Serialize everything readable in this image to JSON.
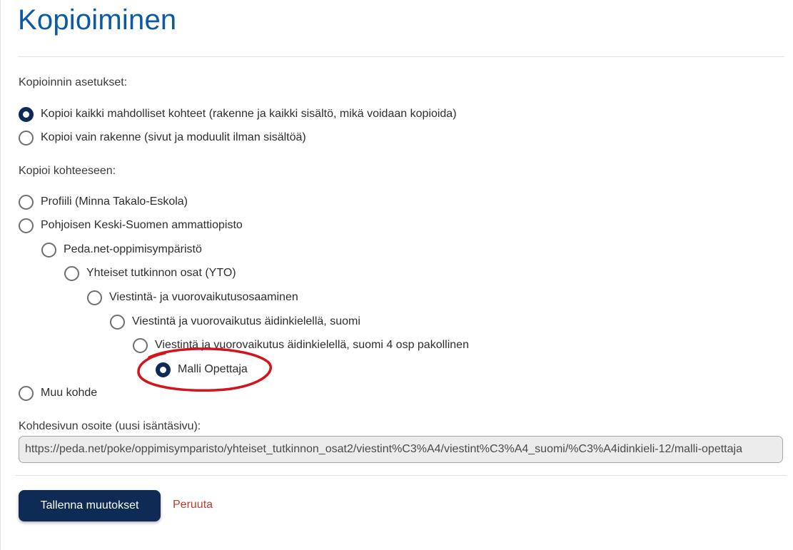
{
  "page": {
    "title": "Kopioiminen"
  },
  "copy_settings": {
    "label": "Kopioinnin asetukset:",
    "options": [
      {
        "label": "Kopioi kaikki mahdolliset kohteet (rakenne ja kaikki sisältö, mikä voidaan kopioida)",
        "checked": true
      },
      {
        "label": "Kopioi vain rakenne (sivut ja moduulit ilman sisältöä)",
        "checked": false
      }
    ]
  },
  "target": {
    "label": "Kopioi kohteeseen:",
    "options": [
      {
        "label": "Profiili (Minna Takalo-Eskola)",
        "checked": false
      },
      {
        "label": "Pohjoisen Keski-Suomen ammattiopisto",
        "checked": false
      },
      {
        "label": "Peda.net-oppimisympäristö",
        "checked": false
      },
      {
        "label": "Yhteiset tutkinnon osat (YTO)",
        "checked": false
      },
      {
        "label": "Viestintä- ja vuorovaikutusosaaminen",
        "checked": false
      },
      {
        "label": "Viestintä ja vuorovaikutus äidinkielellä, suomi",
        "checked": false
      },
      {
        "label": "Viestintä ja vuorovaikutus äidinkielellä, suomi 4 osp pakollinen",
        "checked": false
      },
      {
        "label": "Malli Opettaja",
        "checked": true
      },
      {
        "label": "Muu kohde",
        "checked": false
      }
    ]
  },
  "target_url": {
    "label": "Kohdesivun osoite (uusi isäntäsivu):",
    "value": "https://peda.net/poke/oppimisymparisto/yhteiset_tutkinnon_osat2/viestint%C3%A4/viestint%C3%A4_suomi/%C3%A4idinkieli-12/malli-opettaja"
  },
  "actions": {
    "save_label": "Tallenna muutokset",
    "cancel_label": "Peruuta"
  },
  "colors": {
    "title": "#0b5aa3",
    "primary": "#0d2b55",
    "cancel": "#c0392b",
    "annotation": "#d4141c"
  }
}
